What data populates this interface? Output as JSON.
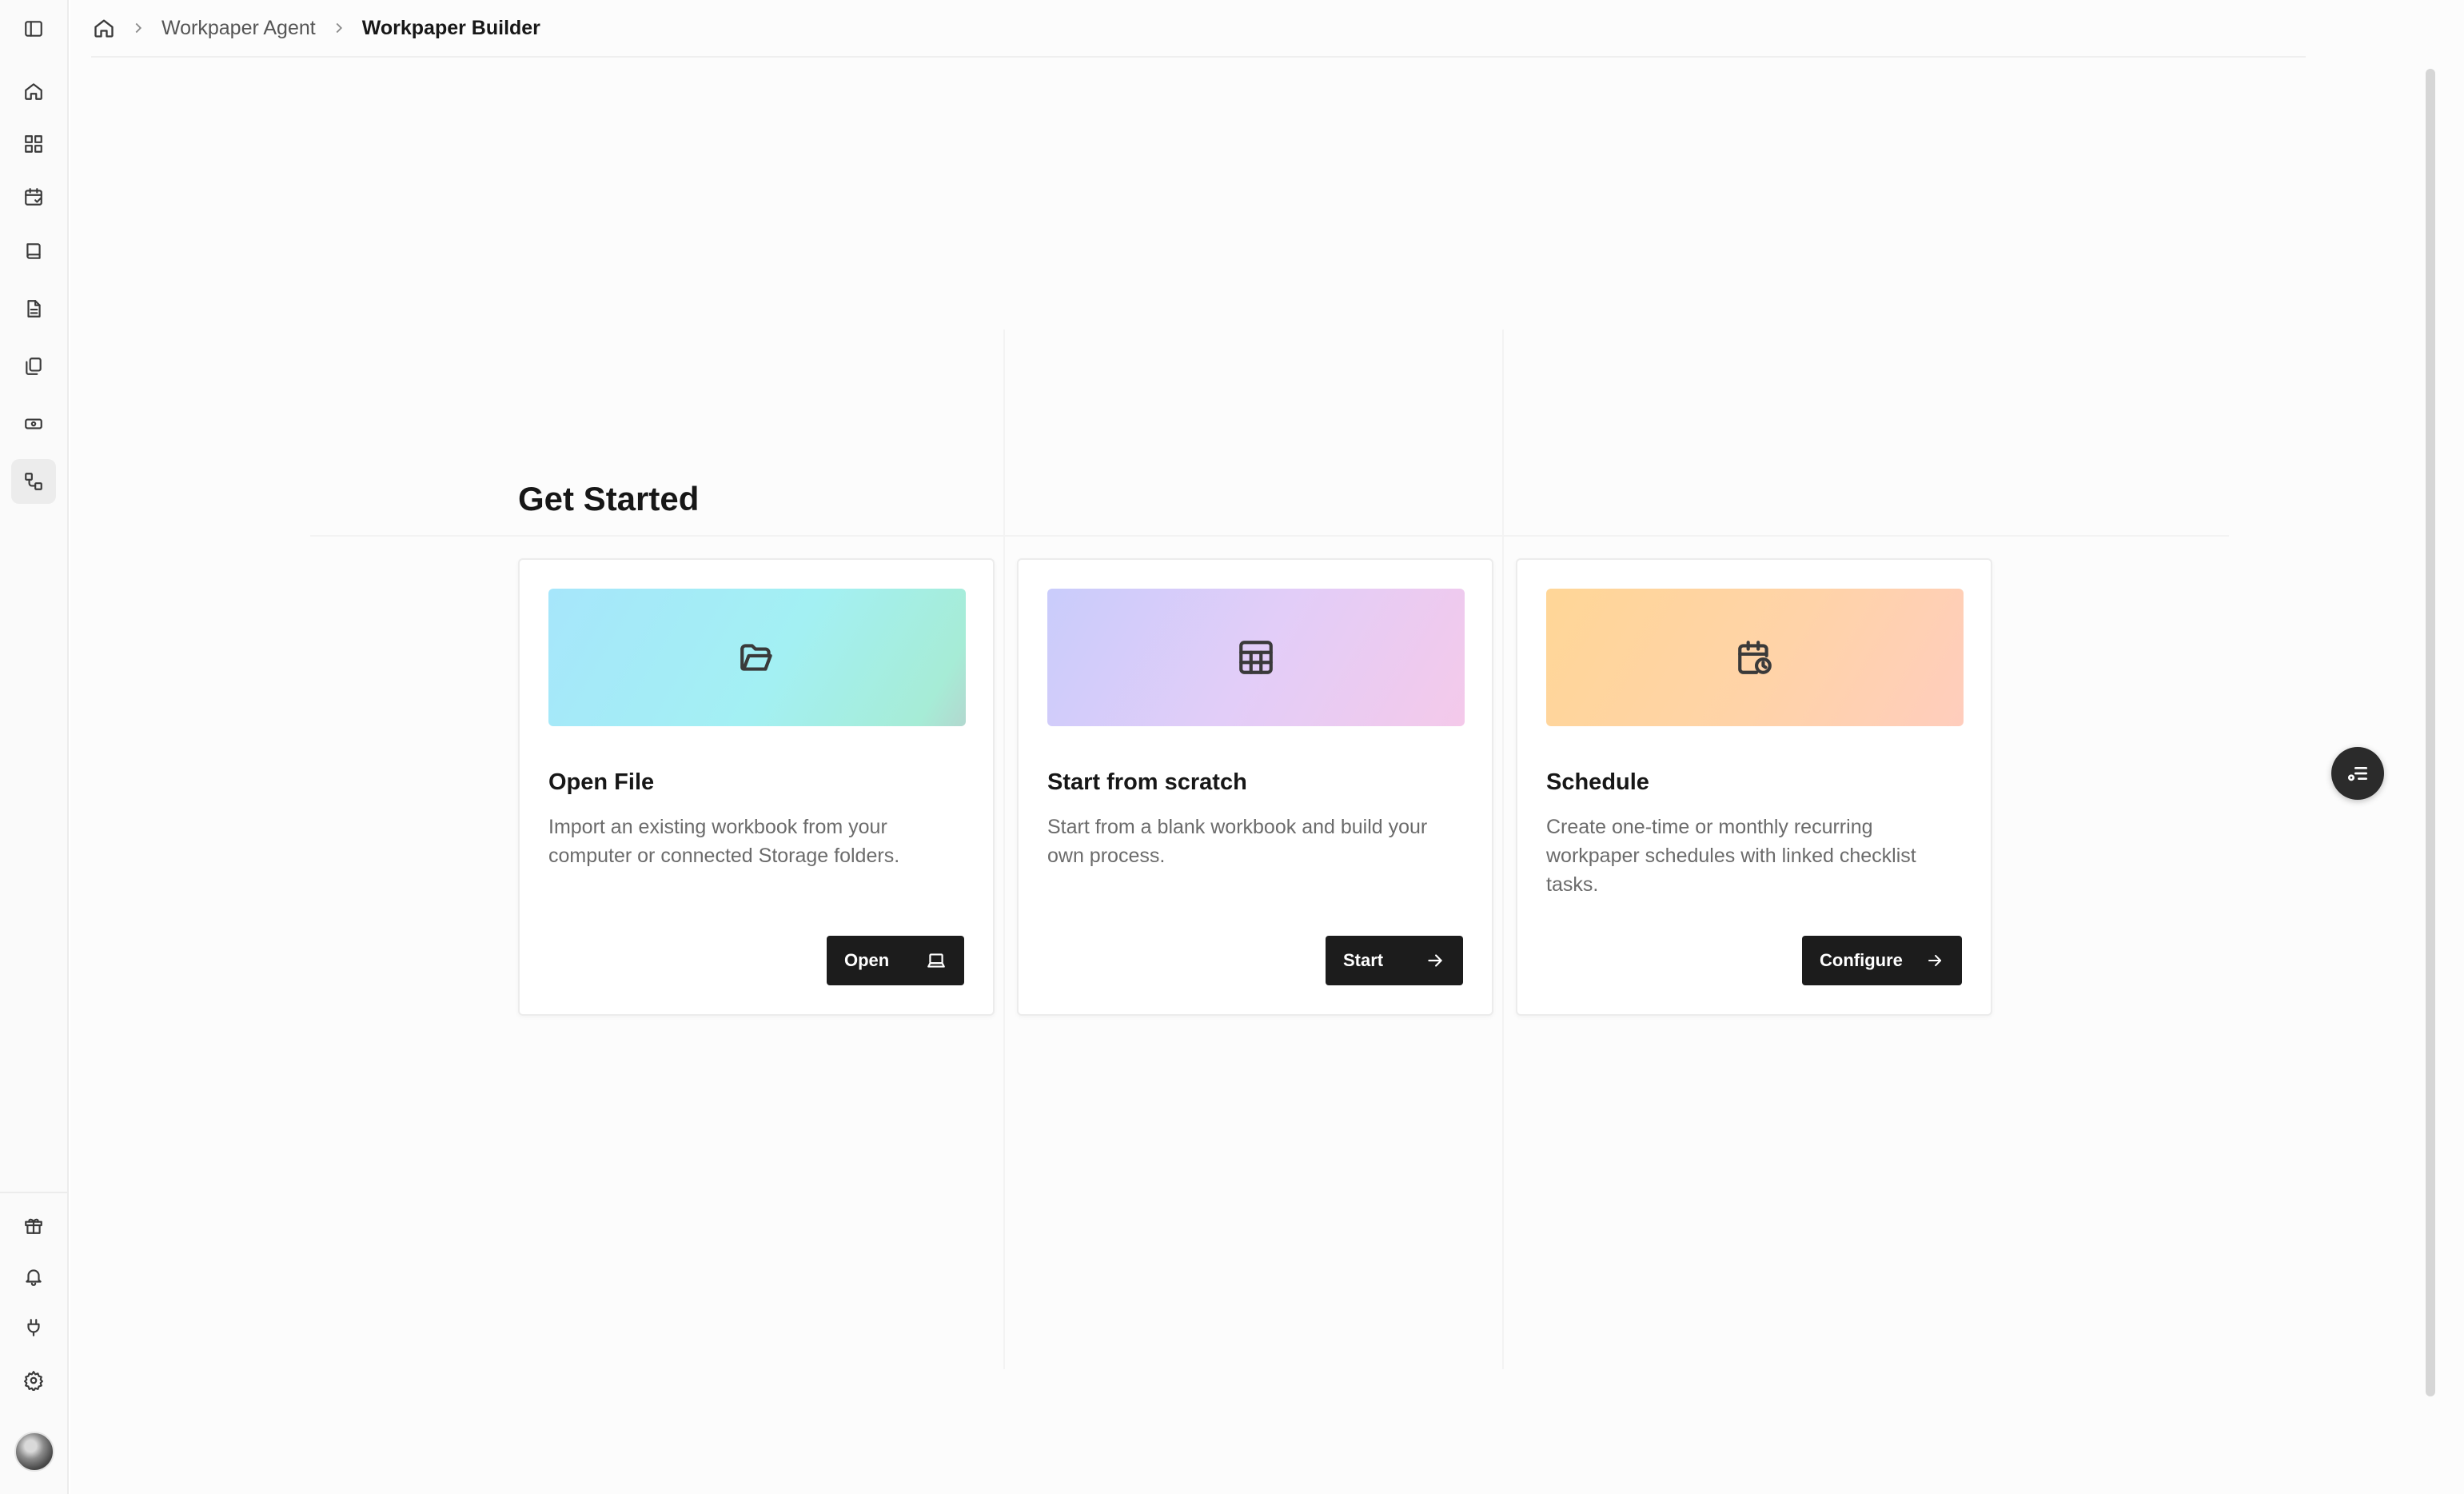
{
  "breadcrumb": {
    "home_icon": "home-icon",
    "items": [
      {
        "label": "Workpaper Agent"
      },
      {
        "label": "Workpaper Builder"
      }
    ]
  },
  "sidebar": {
    "top_icons": [
      "sidebar-toggle-icon",
      "home-icon",
      "dashboard-icon",
      "calendar-check-icon",
      "book-icon",
      "document-icon",
      "copy-icon",
      "money-icon",
      "workflow-icon"
    ],
    "active": "workflow-icon",
    "bottom_icons": [
      "gift-icon",
      "bell-icon",
      "plug-icon",
      "gear-icon"
    ]
  },
  "main": {
    "title": "Get Started",
    "cards": [
      {
        "icon": "folder-open-icon",
        "title": "Open File",
        "description": "Import an existing workbook from your computer or connected Storage folders.",
        "button_label": "Open",
        "button_icon": "laptop-icon"
      },
      {
        "icon": "table-icon",
        "title": "Start from scratch",
        "description": "Start from a blank workbook and build your own process.",
        "button_label": "Start",
        "button_icon": "arrow-right-icon"
      },
      {
        "icon": "calendar-clock-icon",
        "title": "Schedule",
        "description": "Create one-time or monthly recurring workpaper schedules with linked checklist tasks.",
        "button_label": "Configure",
        "button_icon": "arrow-right-icon"
      }
    ]
  },
  "floating_button": {
    "icon": "task-list-icon"
  },
  "colors": {
    "button_bg": "#1c1c1c",
    "card_border": "#ececec",
    "text_muted": "#6b6b6b"
  }
}
